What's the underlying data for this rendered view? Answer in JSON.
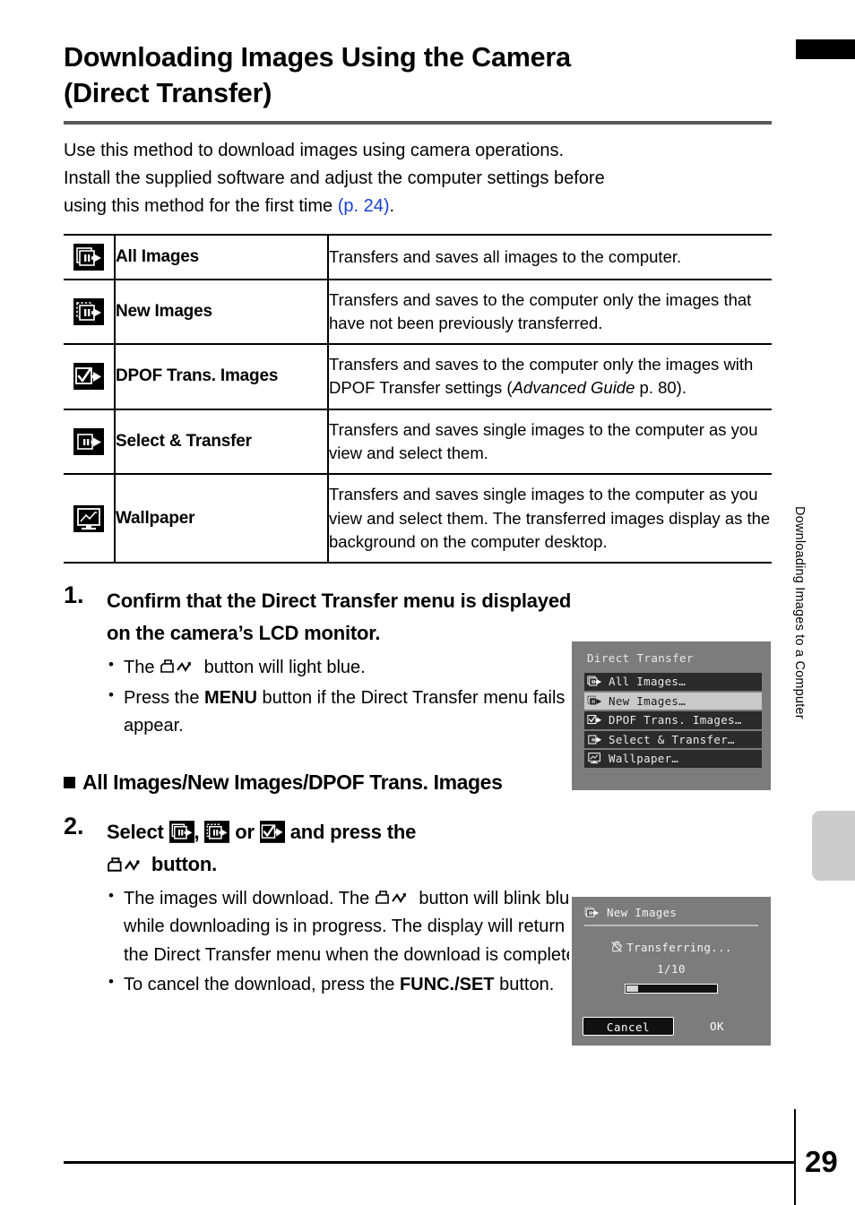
{
  "page": {
    "number": "29",
    "running_head": "Downloading Images to a Computer"
  },
  "title": {
    "line1": "Downloading Images Using the Camera",
    "line2": "(Direct Transfer)"
  },
  "intro": {
    "line1": "Use this method to download images using camera operations.",
    "line2": "Install the supplied software and adjust the computer settings before",
    "line3_before": "using this method for the first time ",
    "link": "(p. 24)",
    "line3_after": "."
  },
  "table": {
    "rows": [
      {
        "icon": "all-images-icon",
        "name": "All Images",
        "desc": "Transfers and saves all images to the computer."
      },
      {
        "icon": "new-images-icon",
        "name": "New Images",
        "desc": "Transfers and saves to the computer only the images that have not been previously transferred."
      },
      {
        "icon": "dpof-trans-images-icon",
        "name": "DPOF Trans. Images",
        "desc_part1": "Transfers and saves to the computer only the images with DPOF Transfer settings (",
        "desc_italic": "Advanced Guide",
        "desc_part2": " p. 80)."
      },
      {
        "icon": "select-transfer-icon",
        "name": "Select & Transfer",
        "desc": "Transfers and saves single images to the computer as you view and select them."
      },
      {
        "icon": "wallpaper-icon",
        "name": "Wallpaper",
        "desc": "Transfers and saves single images to the computer as you view and select them. The transferred images display as the background on the computer desktop."
      }
    ]
  },
  "step1": {
    "number": "1.",
    "heading": "Confirm that the Direct Transfer menu is displayed on the camera’s LCD monitor.",
    "bullet1_before": "The ",
    "bullet1_after": " button will light blue.",
    "bullet2_before": "Press the ",
    "bullet2_bold": "MENU",
    "bullet2_after": " button if the Direct Transfer menu fails to appear."
  },
  "section": {
    "heading": "All Images/New Images/DPOF Trans. Images"
  },
  "step2": {
    "number": "2.",
    "heading_part1": "Select ",
    "heading_comma": ", ",
    "heading_or": " or ",
    "heading_part2": " and press the ",
    "heading_part3": " button.",
    "bullet1_before": "The images will download. The ",
    "bullet1_after": " button will blink blue while downloading is in progress. The display will return to the Direct Transfer menu when the download is complete.",
    "bullet2_before": "To cancel the download, press the ",
    "bullet2_bold": "FUNC./SET",
    "bullet2_after": " button."
  },
  "lcd_menu": {
    "title": "Direct Transfer",
    "items": [
      {
        "icon": "all-images-icon",
        "label": "All Images…",
        "selected": false
      },
      {
        "icon": "new-images-icon",
        "label": "New Images…",
        "selected": true
      },
      {
        "icon": "dpof-trans-images-icon",
        "label": "DPOF Trans. Images…",
        "selected": false
      },
      {
        "icon": "select-transfer-icon",
        "label": "Select & Transfer…",
        "selected": false
      },
      {
        "icon": "wallpaper-icon",
        "label": "Wallpaper…",
        "selected": false
      }
    ]
  },
  "lcd_transfer": {
    "title": "New Images",
    "status": "Transferring...",
    "count": "1/10",
    "progress_percent": 13,
    "cancel_label": "Cancel",
    "ok_label": "OK"
  },
  "colors": {
    "link": "#1a3fd4",
    "lcd_background": "#7c7c7c",
    "lcd_item": "#2b2b2b",
    "lcd_item_selected": "#c9c9c9",
    "rule": "#595959",
    "side_tab": "#cccccc"
  }
}
